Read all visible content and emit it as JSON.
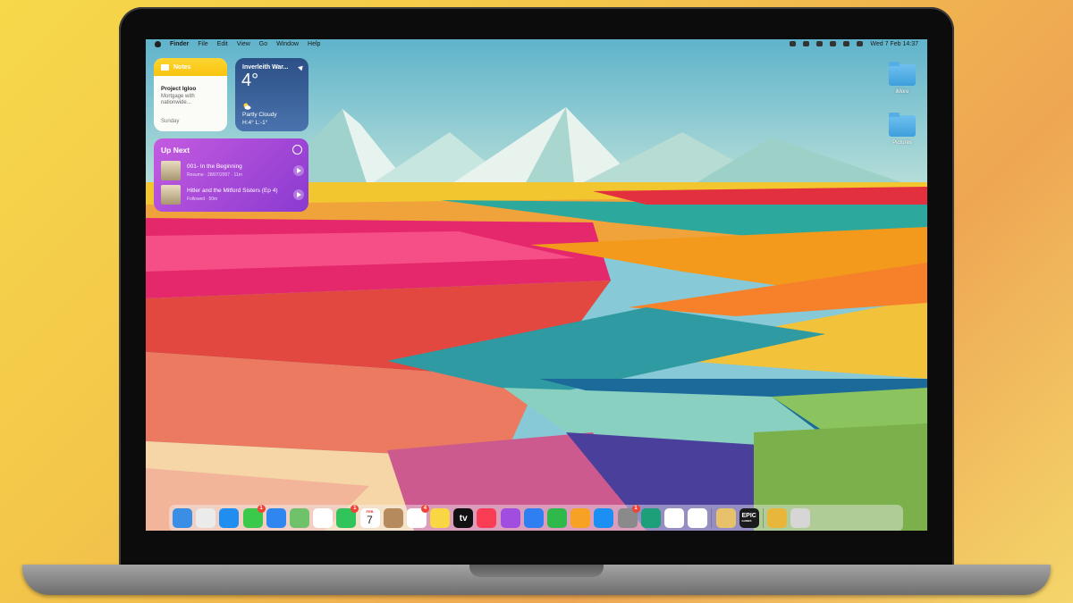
{
  "menubar": {
    "items": [
      "Finder",
      "File",
      "Edit",
      "View",
      "Go",
      "Window",
      "Help"
    ],
    "clock": "Wed 7 Feb  14:37"
  },
  "widgets": {
    "notes": {
      "app": "Notes",
      "title": "Project Igloo",
      "body": "Mortgage with nationwide...",
      "date": "Sunday"
    },
    "weather": {
      "location": "Inverleith War...",
      "temp": "4°",
      "condition": "Partly Cloudy",
      "high_low": "H:4° L:-1°"
    },
    "up_next": {
      "title": "Up Next",
      "episodes": [
        {
          "name": "001- In the Beginning",
          "meta": "Resume · 28/07/2007 · 11m"
        },
        {
          "name": "Hitler and the Mitford Sisters (Ep 4)",
          "meta": "Followed · 50m"
        }
      ]
    }
  },
  "desktop": {
    "folders": [
      {
        "label": "iMore"
      },
      {
        "label": "Pictures"
      }
    ]
  },
  "dock": {
    "apps": [
      {
        "name": "Finder",
        "icon": "finder-icon",
        "color": "#3a8ee6"
      },
      {
        "name": "Launchpad",
        "icon": "launchpad-icon",
        "color": "#ebebeb"
      },
      {
        "name": "Safari",
        "icon": "safari-icon",
        "color": "#1f8ef0"
      },
      {
        "name": "Messages",
        "icon": "messages-icon",
        "color": "#3bc94c",
        "badge": "1"
      },
      {
        "name": "Mail",
        "icon": "mail-icon",
        "color": "#2f86f0"
      },
      {
        "name": "Maps",
        "icon": "maps-icon",
        "color": "#6fc26a"
      },
      {
        "name": "Photos",
        "icon": "photos-icon",
        "color": "#ffffff"
      },
      {
        "name": "FaceTime",
        "icon": "facetime-icon",
        "color": "#30c45a",
        "badge": "1"
      },
      {
        "name": "Calendar",
        "icon": "calendar-icon",
        "color": "#ffffff",
        "month": "FEB",
        "day": "7"
      },
      {
        "name": "Contacts",
        "icon": "contacts-icon",
        "color": "#b58a5c"
      },
      {
        "name": "Reminders",
        "icon": "reminders-icon",
        "color": "#ffffff",
        "badge": "4"
      },
      {
        "name": "Notes",
        "icon": "notes-icon",
        "color": "#f9d742"
      },
      {
        "name": "Apple TV",
        "icon": "tv-icon",
        "color": "#111111",
        "label": "tv"
      },
      {
        "name": "Music",
        "icon": "music-icon",
        "color": "#fa3c55"
      },
      {
        "name": "Podcasts",
        "icon": "podcasts-icon",
        "color": "#a14de0"
      },
      {
        "name": "Keynote",
        "icon": "keynote-icon",
        "color": "#2f7ef2"
      },
      {
        "name": "Numbers",
        "icon": "numbers-icon",
        "color": "#2fb94a"
      },
      {
        "name": "Pages",
        "icon": "pages-icon",
        "color": "#f7a125"
      },
      {
        "name": "App Store",
        "icon": "appstore-icon",
        "color": "#1c8ff5"
      },
      {
        "name": "System Settings",
        "icon": "settings-icon",
        "color": "#8a8a8a",
        "badge": "1"
      },
      {
        "name": "Edge",
        "icon": "edge-icon",
        "color": "#1da07a"
      },
      {
        "name": "Slack",
        "icon": "slack-icon",
        "color": "#ffffff"
      },
      {
        "name": "Chrome",
        "icon": "chrome-icon",
        "color": "#ffffff"
      },
      {
        "name": "Pixelmator",
        "icon": "pixelmator-icon",
        "color": "#e8c26a"
      },
      {
        "name": "Epic Games",
        "icon": "epic-icon",
        "color": "#1a1a1a",
        "label": "EPIC",
        "sub": "GAMES"
      },
      {
        "name": "Archive",
        "icon": "archive-icon",
        "color": "#e9b63c"
      },
      {
        "name": "Trash",
        "icon": "trash-icon",
        "color": "#d6d6d6"
      }
    ]
  }
}
